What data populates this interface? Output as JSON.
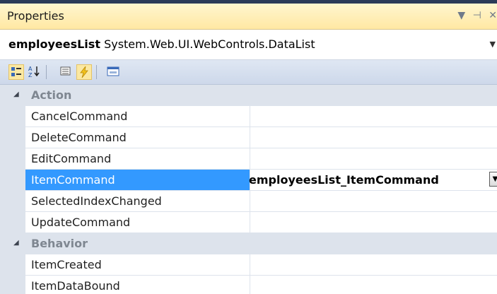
{
  "window": {
    "title": "Properties"
  },
  "object_selector": {
    "name": "employeesList",
    "type": "System.Web.UI.WebControls.DataList"
  },
  "icons": {
    "pin": "pin-icon",
    "close": "close-icon",
    "dropdown": "dropdown-arrow-icon",
    "categorized": "categorized-icon",
    "alphabetical": "alphabetical-sort-icon",
    "properties": "properties-icon",
    "events": "events-lightning-icon",
    "property_pages": "property-pages-icon"
  },
  "colors": {
    "selection": "#3399ff",
    "category_bg": "#dde3ec",
    "title_bg": "#ffe8a3"
  },
  "categories": [
    {
      "label": "Action",
      "rows": [
        {
          "name": "CancelCommand",
          "value": ""
        },
        {
          "name": "DeleteCommand",
          "value": ""
        },
        {
          "name": "EditCommand",
          "value": ""
        },
        {
          "name": "ItemCommand",
          "value": "employeesList_ItemCommand",
          "selected": true
        },
        {
          "name": "SelectedIndexChanged",
          "value": ""
        },
        {
          "name": "UpdateCommand",
          "value": ""
        }
      ]
    },
    {
      "label": "Behavior",
      "rows": [
        {
          "name": "ItemCreated",
          "value": ""
        },
        {
          "name": "ItemDataBound",
          "value": ""
        }
      ]
    }
  ]
}
